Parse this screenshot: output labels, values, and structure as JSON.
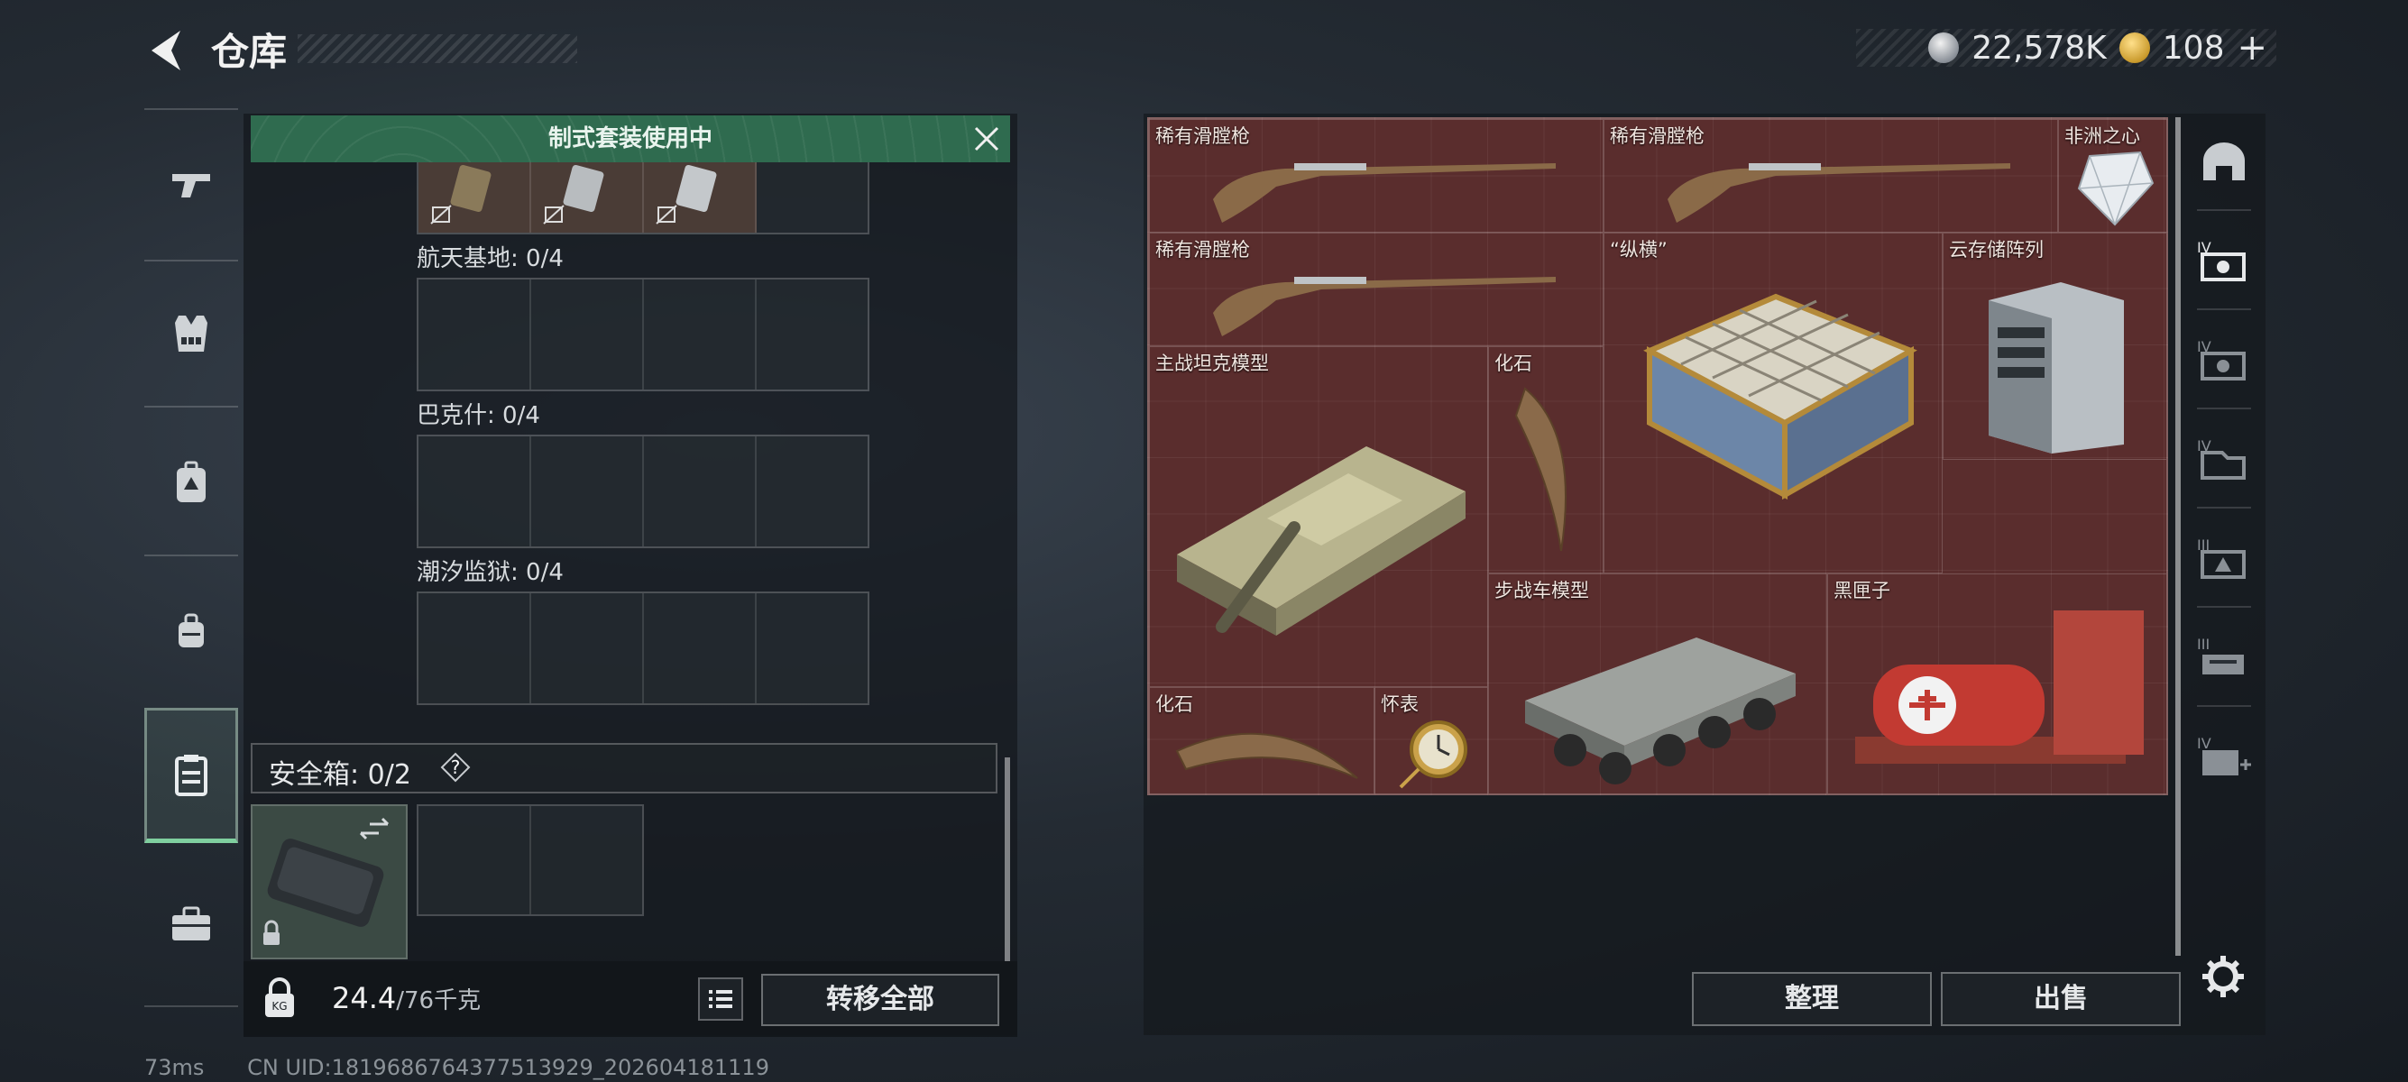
{
  "header": {
    "title": "仓库",
    "currency": [
      {
        "icon": "silver-coin-icon",
        "value": "22,578K"
      },
      {
        "icon": "gold-coin-icon",
        "value": "108"
      }
    ],
    "add_label": "+"
  },
  "left_rail": {
    "items": [
      {
        "icon": "gun-icon"
      },
      {
        "icon": "vest-icon"
      },
      {
        "icon": "backpack-icon"
      },
      {
        "icon": "pouch-icon"
      },
      {
        "icon": "safebox-icon",
        "active": true
      },
      {
        "icon": "toolbox-icon"
      }
    ]
  },
  "left_panel": {
    "banner_text": "制式套装使用中",
    "sets": [
      {
        "label": "航天基地: 0/4"
      },
      {
        "label": "巴克什: 0/4"
      },
      {
        "label": "潮汐监狱: 0/4"
      }
    ],
    "safebox_label": "安全箱: 0/2",
    "safebox_help": "?",
    "weight": {
      "current": "24.4",
      "max": "/76千克"
    },
    "transfer_all": "转移全部"
  },
  "grid_items": [
    {
      "name": "稀有滑膛枪",
      "icon": "musket-icon"
    },
    {
      "name": "稀有滑膛枪",
      "icon": "musket-icon"
    },
    {
      "name": "非洲之心",
      "icon": "diamond-icon"
    },
    {
      "name": "稀有滑膛枪",
      "icon": "musket-icon"
    },
    {
      "name": "“纵横”",
      "icon": "chessboard-icon"
    },
    {
      "name": "云存储阵列",
      "icon": "server-icon"
    },
    {
      "name": "主战坦克模型",
      "icon": "tank-icon"
    },
    {
      "name": "化石",
      "icon": "fossil-claw-icon"
    },
    {
      "name": "步战车模型",
      "icon": "ifv-icon"
    },
    {
      "name": "黑匣子",
      "icon": "black-box-icon"
    },
    {
      "name": "化石",
      "icon": "fossil-claw-icon"
    },
    {
      "name": "怀表",
      "icon": "pocket-watch-icon"
    }
  ],
  "actions": {
    "sort": "整理",
    "sell": "出售"
  },
  "right_rail": {
    "items": [
      {
        "icon": "bunker-icon",
        "tier": ""
      },
      {
        "icon": "storage-tier-icon",
        "tier": "IV"
      },
      {
        "icon": "storage-tier-icon",
        "tier": "IV"
      },
      {
        "icon": "storage-tier-icon",
        "tier": "IV"
      },
      {
        "icon": "storage-tier-icon",
        "tier": "III"
      },
      {
        "icon": "storage-tier-icon",
        "tier": "III"
      },
      {
        "icon": "storage-tier-icon",
        "tier": "IV"
      }
    ]
  },
  "status": {
    "ping": "73ms",
    "uid": "CN UID:1819686764377513929_202604181119"
  }
}
